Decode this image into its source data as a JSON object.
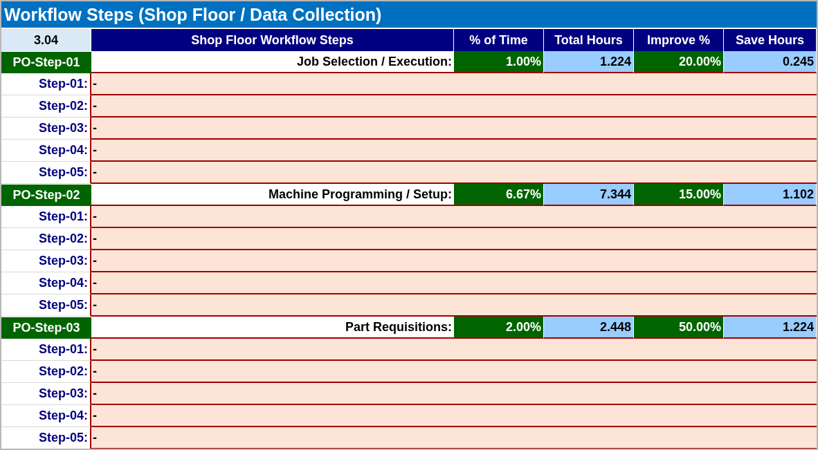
{
  "title": "Workflow Steps (Shop Floor / Data Collection)",
  "corner": "3.04",
  "columns": [
    "Shop Floor Workflow Steps",
    "% of Time",
    "Total Hours",
    "Improve %",
    "Save Hours"
  ],
  "groups": [
    {
      "code": "PO-Step-01",
      "name": "Job Selection / Execution:",
      "pct_time": "1.00%",
      "total_hours": "1.224",
      "improve": "20.00%",
      "save_hours": "0.245",
      "steps": [
        {
          "label": "Step-01:",
          "text": "-"
        },
        {
          "label": "Step-02:",
          "text": "-"
        },
        {
          "label": "Step-03:",
          "text": "-"
        },
        {
          "label": "Step-04:",
          "text": "-"
        },
        {
          "label": "Step-05:",
          "text": "-"
        }
      ]
    },
    {
      "code": "PO-Step-02",
      "name": "Machine Programming / Setup:",
      "pct_time": "6.67%",
      "total_hours": "7.344",
      "improve": "15.00%",
      "save_hours": "1.102",
      "steps": [
        {
          "label": "Step-01:",
          "text": "-"
        },
        {
          "label": "Step-02:",
          "text": "-"
        },
        {
          "label": "Step-03:",
          "text": "-"
        },
        {
          "label": "Step-04:",
          "text": "-"
        },
        {
          "label": "Step-05:",
          "text": "-"
        }
      ]
    },
    {
      "code": "PO-Step-03",
      "name": "Part Requisitions:",
      "pct_time": "2.00%",
      "total_hours": "2.448",
      "improve": "50.00%",
      "save_hours": "1.224",
      "steps": [
        {
          "label": "Step-01:",
          "text": "-"
        },
        {
          "label": "Step-02:",
          "text": "-"
        },
        {
          "label": "Step-03:",
          "text": "-"
        },
        {
          "label": "Step-04:",
          "text": "-"
        },
        {
          "label": "Step-05:",
          "text": "-"
        }
      ]
    }
  ]
}
